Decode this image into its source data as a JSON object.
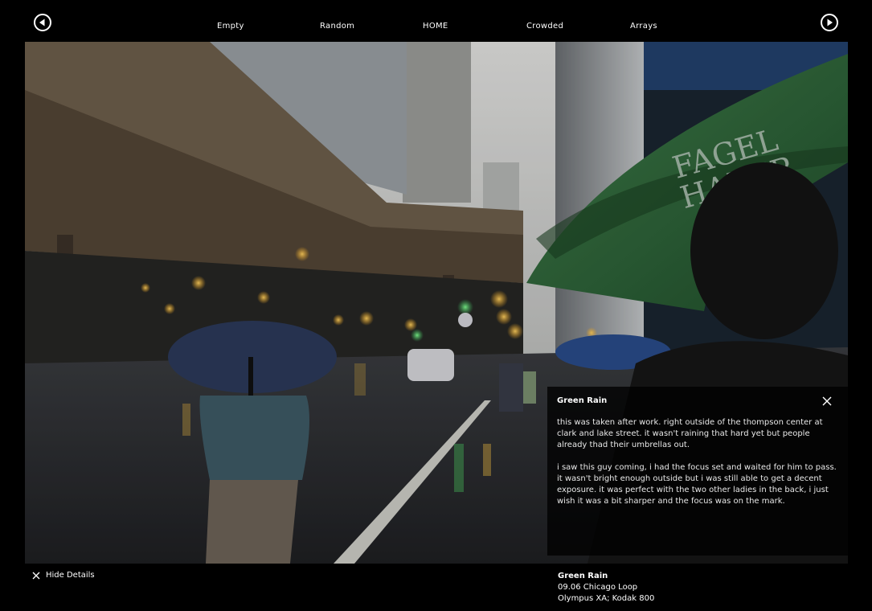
{
  "nav": {
    "items": [
      "Empty",
      "Random",
      "HOME",
      "Crowded",
      "Arrays"
    ]
  },
  "photo": {
    "umbrella_text_line1": "FAGEL",
    "umbrella_text_line2": "HABER"
  },
  "details": {
    "title": "Green Rain",
    "paragraph1": "this was taken after work. right outside of the thompson center at clark and lake street. it wasn't raining that hard yet but people already thad their umbrellas out.",
    "paragraph2": "i saw this guy coming, i had the focus set and waited for him to pass. it wasn't bright enough outside but i was still able to get a decent exposure. it was perfect with the two other ladies in the back, i just wish it was a bit sharper and the focus was on the mark."
  },
  "footer": {
    "hide_details_label": "Hide Details",
    "caption_title": "Green Rain",
    "caption_line1": "09.06 Chicago Loop",
    "caption_line2": "Olympus XA; Kodak 800"
  },
  "icons": {
    "prev": "arrow-left-circle-icon",
    "next": "arrow-right-circle-icon",
    "close": "close-icon"
  },
  "colors": {
    "background": "#000000",
    "umbrella_green": "#2f6a3a",
    "umbrella_blue": "#2c3a5a"
  }
}
